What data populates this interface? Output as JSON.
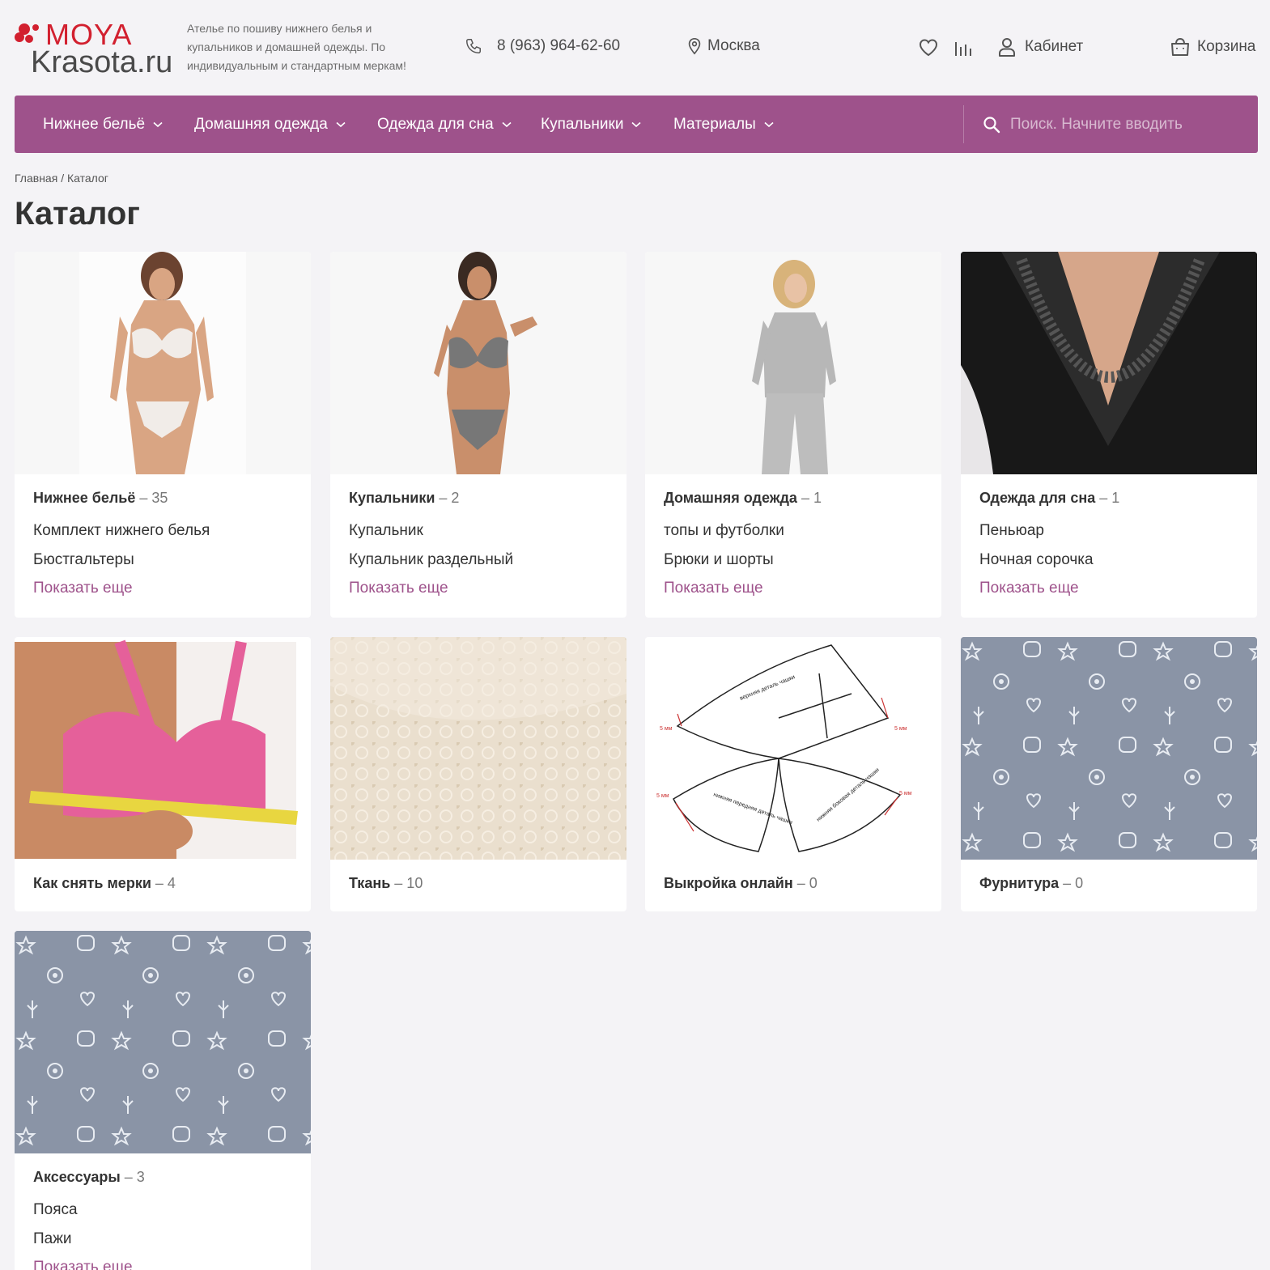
{
  "header": {
    "logo": {
      "moya": "MOYA",
      "krasota": "Krasota.ru"
    },
    "tagline": "Ателье по пошиву нижнего белья и купальников и домашней одежды. По индивидуальным и стандартным меркам!",
    "phone": "8 (963) 964-62-60",
    "city": "Москва",
    "cabinet": "Кабинет",
    "cart": "Корзина"
  },
  "nav": {
    "items": [
      {
        "label": "Нижнее бельё"
      },
      {
        "label": "Домашняя одежда"
      },
      {
        "label": "Одежда для сна"
      },
      {
        "label": "Купальники"
      },
      {
        "label": "Материалы"
      }
    ],
    "search_placeholder": "Поиск. Начните вводить"
  },
  "breadcrumb": {
    "home": "Главная",
    "sep": "/",
    "current": "Каталог"
  },
  "page_title": "Каталог",
  "colors": {
    "accent": "#9e528b",
    "logo_red": "#d2202f",
    "pattern": "#8a94a6"
  },
  "cards": [
    {
      "title": "Нижнее бельё",
      "count": "– 35",
      "subs": [
        "Комплект нижнего белья",
        "Бюстгальтеры"
      ],
      "more": "Показать еще"
    },
    {
      "title": "Купальники",
      "count": "– 2",
      "subs": [
        "Купальник",
        "Купальник раздельный"
      ],
      "more": "Показать еще"
    },
    {
      "title": "Домашняя одежда",
      "count": "– 1",
      "subs": [
        "топы и футболки",
        "Брюки и шорты"
      ],
      "more": "Показать еще"
    },
    {
      "title": "Одежда для сна",
      "count": "– 1",
      "subs": [
        "Пеньюар",
        "Ночная сорочка"
      ],
      "more": "Показать еще"
    },
    {
      "title": "Как снять мерки",
      "count": "– 4"
    },
    {
      "title": "Ткань",
      "count": "– 10"
    },
    {
      "title": "Выкройка онлайн",
      "count": "– 0"
    },
    {
      "title": "Фурнитура ",
      "count": " – 0"
    },
    {
      "title": "Аксессуары",
      "count": "– 3",
      "subs": [
        "Пояса",
        "Пажи"
      ],
      "more": "Показать еще"
    }
  ],
  "pattern_labels": {
    "pattern_1": "5 мм",
    "pattern_2": "верхняя деталь чашки",
    "pattern_3": "нижняя передняя деталь чашки",
    "pattern_4": "нижняя боковая деталь чашки"
  }
}
